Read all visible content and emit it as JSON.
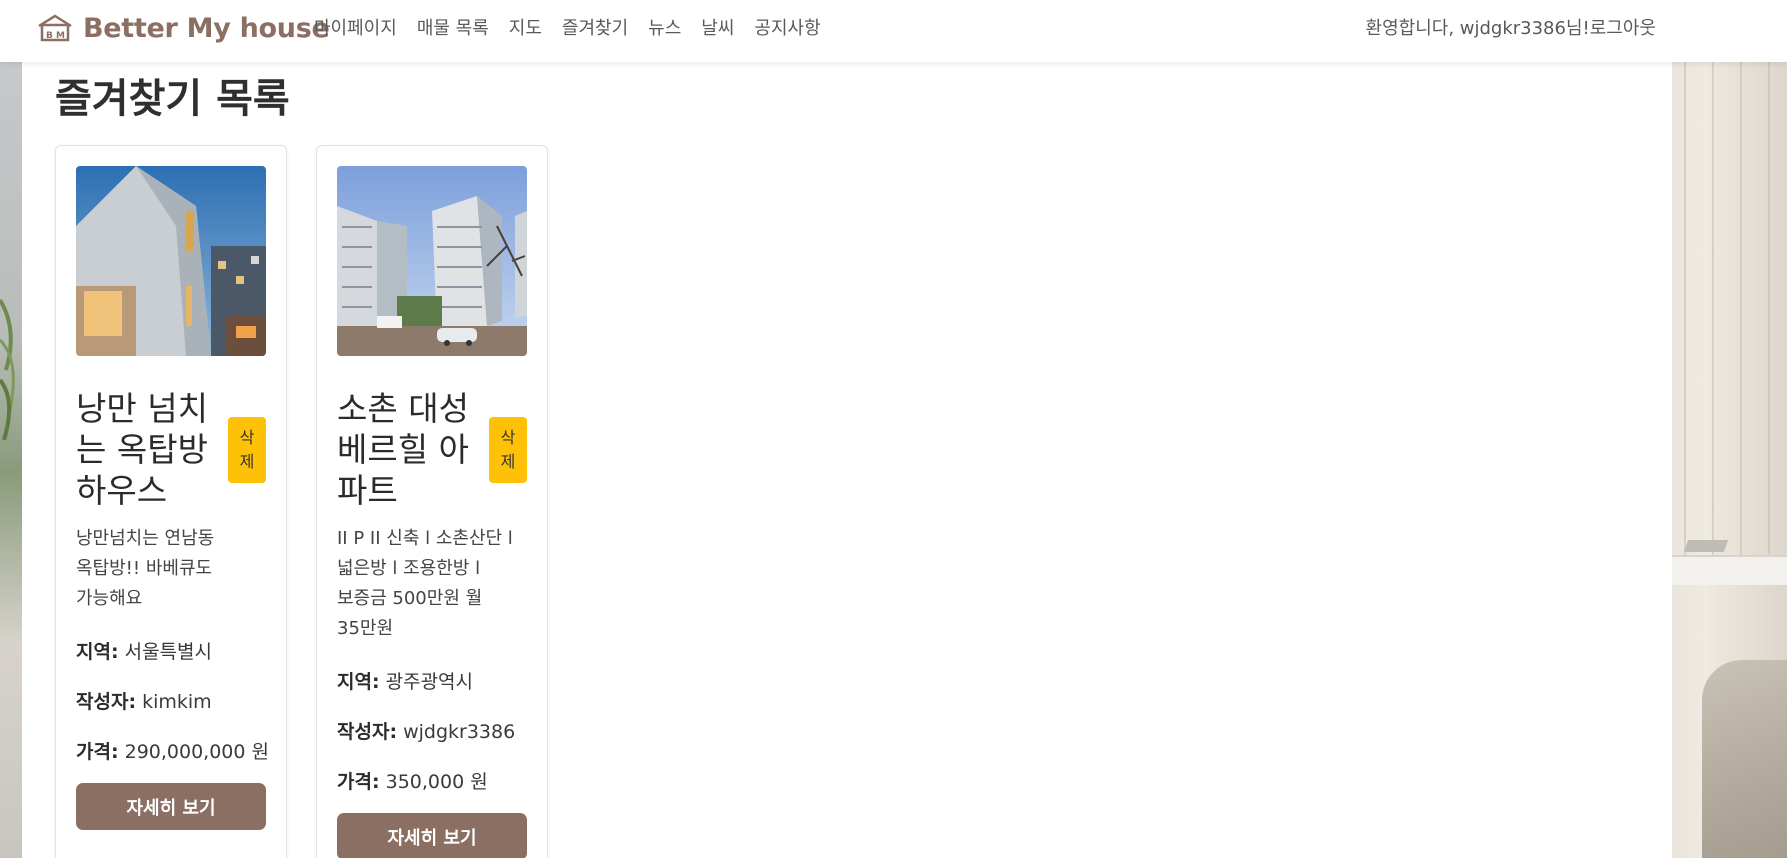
{
  "brand": {
    "name": "Better My house",
    "color": "#8b6f62"
  },
  "nav": {
    "links": [
      "마이페이지",
      "매물 목록",
      "지도",
      "즐겨찾기",
      "뉴스",
      "날씨",
      "공지사항"
    ],
    "welcome": "환영합니다, wjdgkr3386님!",
    "logout": "로그아웃"
  },
  "page": {
    "title": "즐겨찾기 목록"
  },
  "labels": {
    "region": "지역:",
    "author": "작성자:",
    "price": "가격:",
    "delete": "삭제",
    "detail": "자세히 보기"
  },
  "favorites": [
    {
      "title": "낭만 넘치는 옥탑방 하우스",
      "description": "낭만넘치는 연남동 옥탑방!! 바베큐도 가능해요",
      "region": "서울특별시",
      "author": "kimkim",
      "price": "290,000,000 원"
    },
    {
      "title": "소촌 대성 베르힐 아파트",
      "description": "II P II 신축 l 소촌산단 l 넓은방 l 조용한방 l 보증금 500만원 월 35만원",
      "region": "광주광역시",
      "author": "wjdgkr3386",
      "price": "350,000 원"
    }
  ],
  "colors": {
    "accent": "#8b6f62",
    "delete": "#ffc107"
  }
}
